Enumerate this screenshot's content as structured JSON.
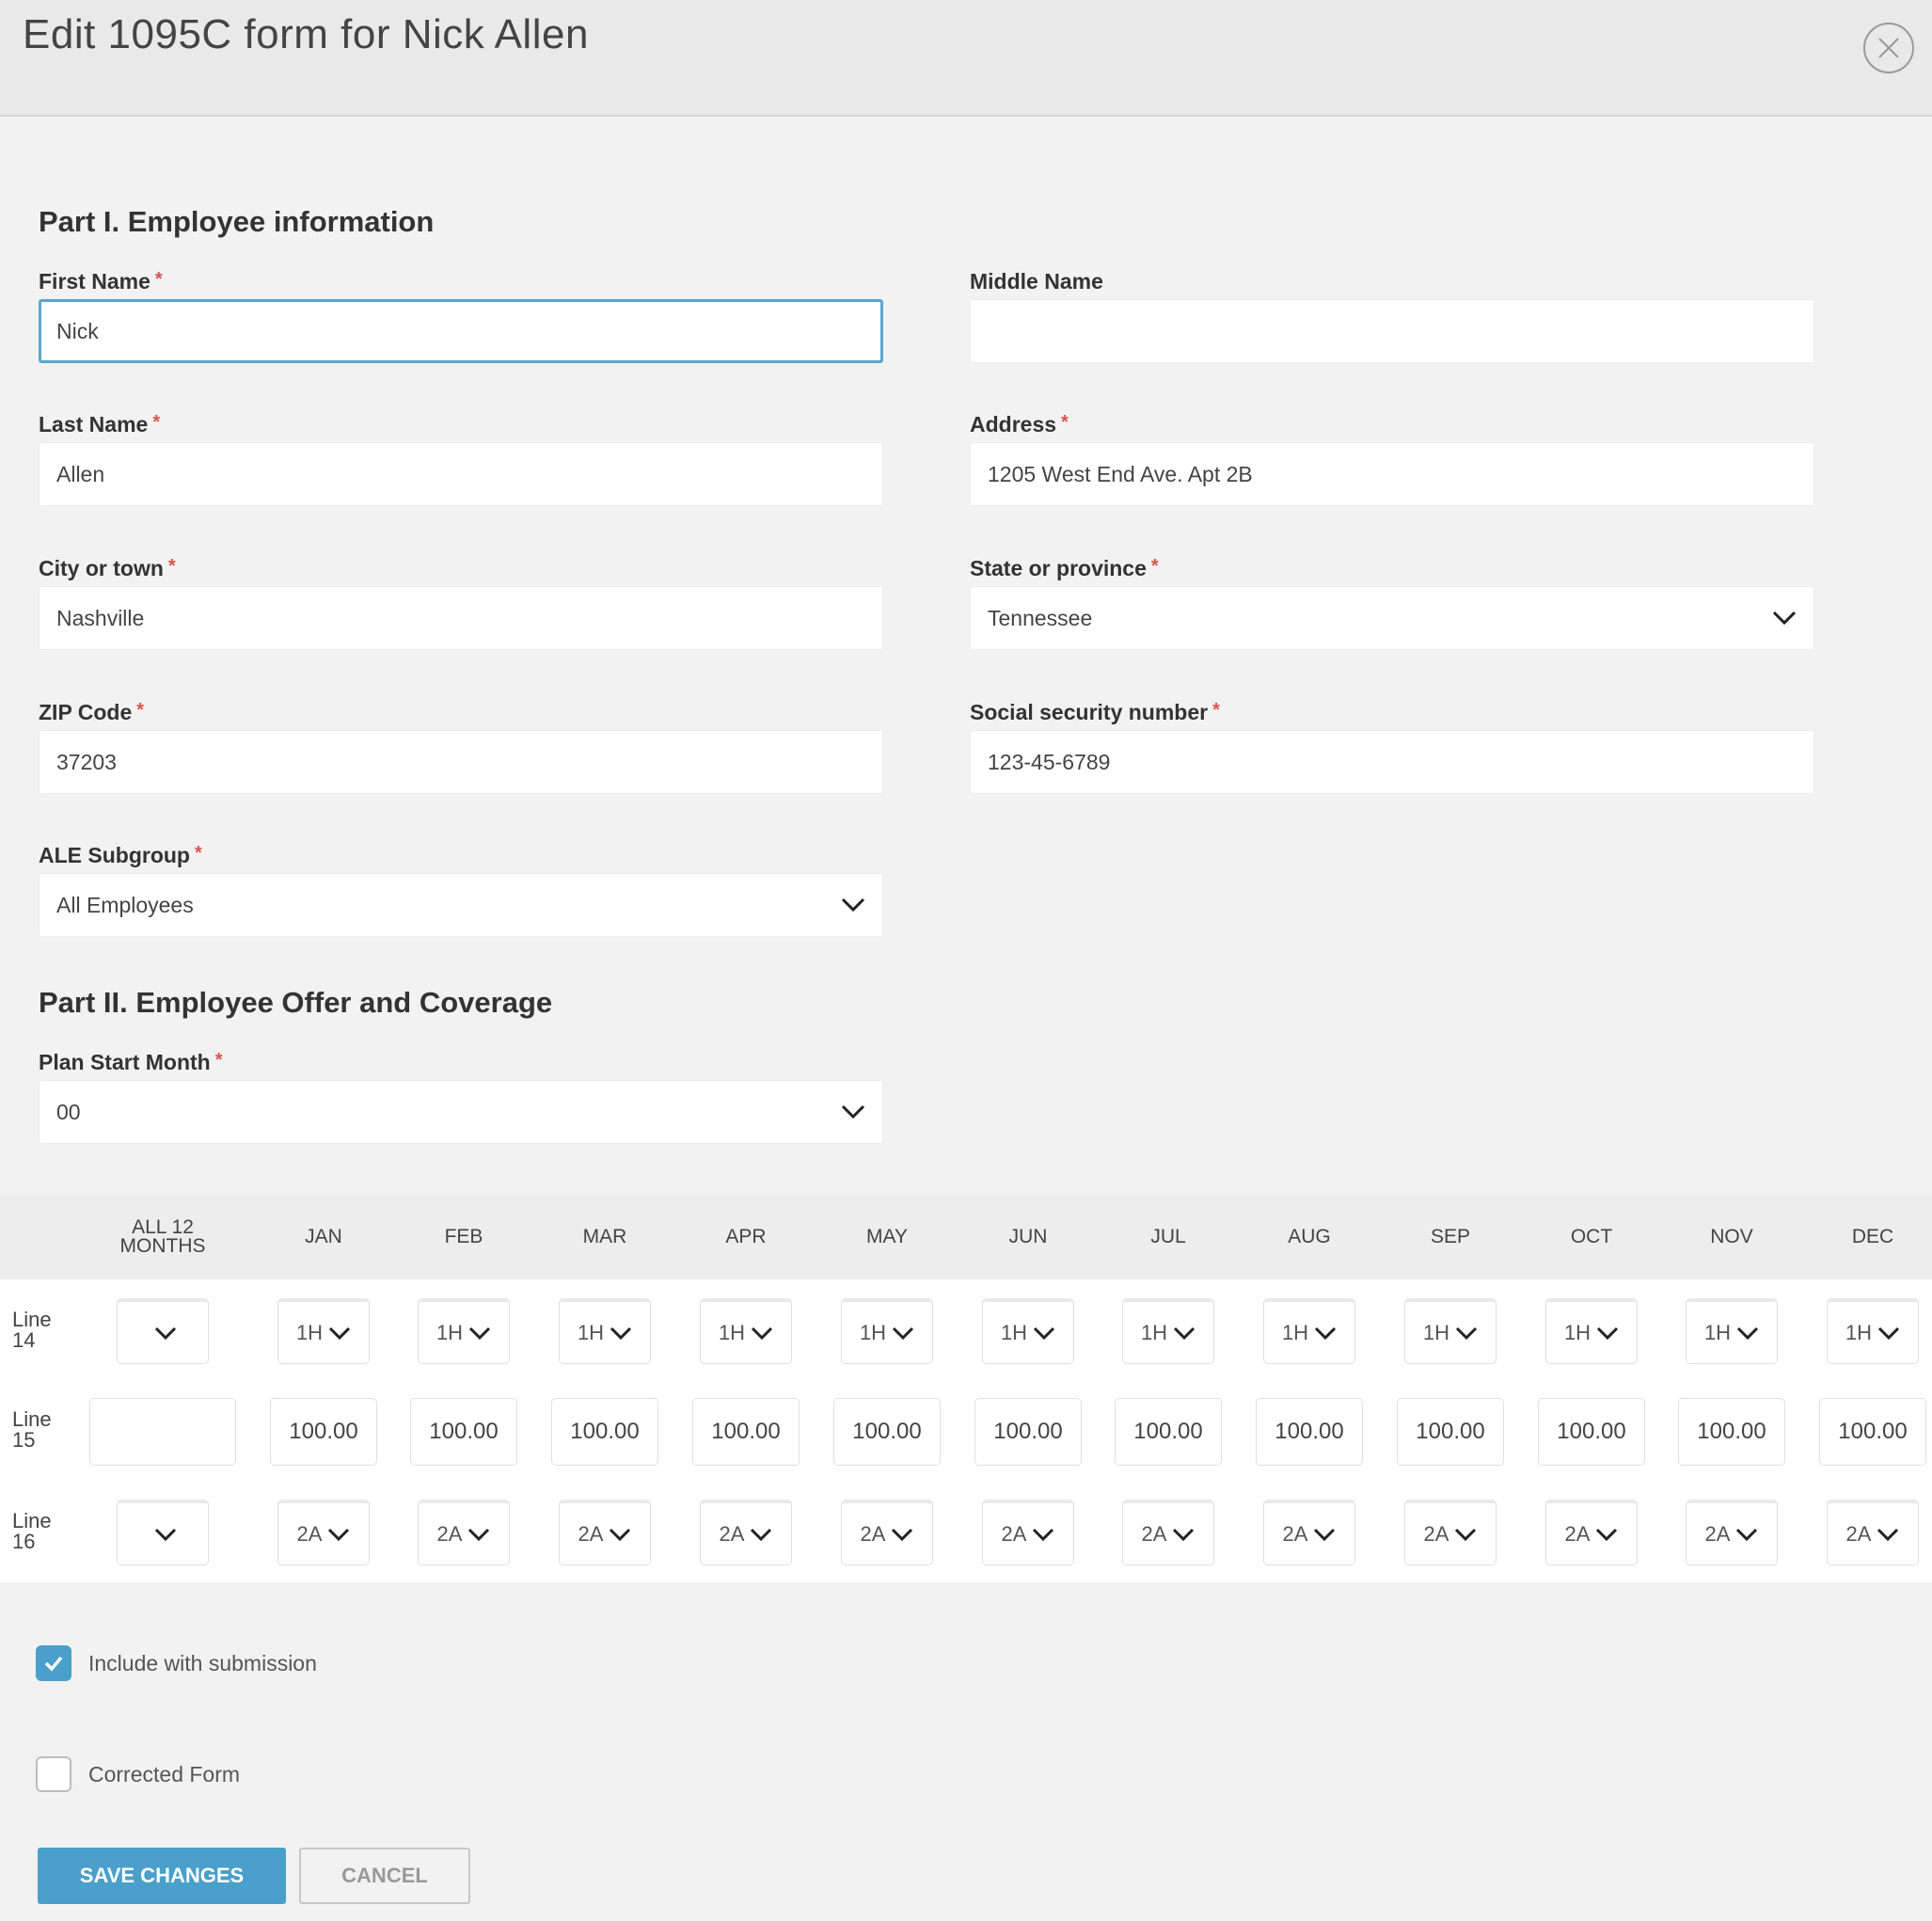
{
  "header": {
    "title": "Edit 1095C form for Nick Allen",
    "close_label": "X"
  },
  "part1": {
    "title": "Part I. Employee information"
  },
  "fields": {
    "first_name": {
      "label": "First Name",
      "value": "Nick"
    },
    "middle_name": {
      "label": "Middle Name",
      "value": ""
    },
    "last_name": {
      "label": "Last Name",
      "value": "Allen"
    },
    "address": {
      "label": "Address",
      "value": "1205 West End Ave. Apt 2B"
    },
    "city": {
      "label": "City or town",
      "value": "Nashville"
    },
    "state": {
      "label": "State or province",
      "value": "Tennessee"
    },
    "zip": {
      "label": "ZIP Code",
      "value": "37203"
    },
    "ssn": {
      "label": "Social security number",
      "value": "123-45-6789"
    },
    "ale_subgroup": {
      "label": "ALE Subgroup",
      "value": "All Employees"
    }
  },
  "required_marker": "*",
  "part2": {
    "title": "Part II. Employee Offer and Coverage",
    "plan_start": {
      "label": "Plan Start Month",
      "value": "00"
    }
  },
  "grid": {
    "columns": [
      "ALL 12 MONTHS",
      "JAN",
      "FEB",
      "MAR",
      "APR",
      "MAY",
      "JUN",
      "JUL",
      "AUG",
      "SEP",
      "OCT",
      "NOV",
      "DEC"
    ],
    "rows": [
      {
        "label": "Line 14",
        "type": "select",
        "values": [
          "",
          "1H",
          "1H",
          "1H",
          "1H",
          "1H",
          "1H",
          "1H",
          "1H",
          "1H",
          "1H",
          "1H",
          "1H"
        ]
      },
      {
        "label": "Line 15",
        "type": "input",
        "values": [
          "",
          "100.00",
          "100.00",
          "100.00",
          "100.00",
          "100.00",
          "100.00",
          "100.00",
          "100.00",
          "100.00",
          "100.00",
          "100.00",
          "100.00"
        ]
      },
      {
        "label": "Line 16",
        "type": "select",
        "values": [
          "",
          "2A",
          "2A",
          "2A",
          "2A",
          "2A",
          "2A",
          "2A",
          "2A",
          "2A",
          "2A",
          "2A",
          "2A"
        ]
      }
    ]
  },
  "checkboxes": {
    "include": {
      "label": "Include with submission",
      "checked": true
    },
    "corrected": {
      "label": "Corrected Form",
      "checked": false
    }
  },
  "buttons": {
    "save": "SAVE CHANGES",
    "cancel": "CANCEL"
  },
  "colors": {
    "accent": "#4a9fcb",
    "focus_border": "#5ba6cc",
    "required": "#d9534f"
  },
  "icons": {
    "close": "close-icon",
    "dropdown": "chevron-down-icon",
    "check": "check-icon"
  }
}
